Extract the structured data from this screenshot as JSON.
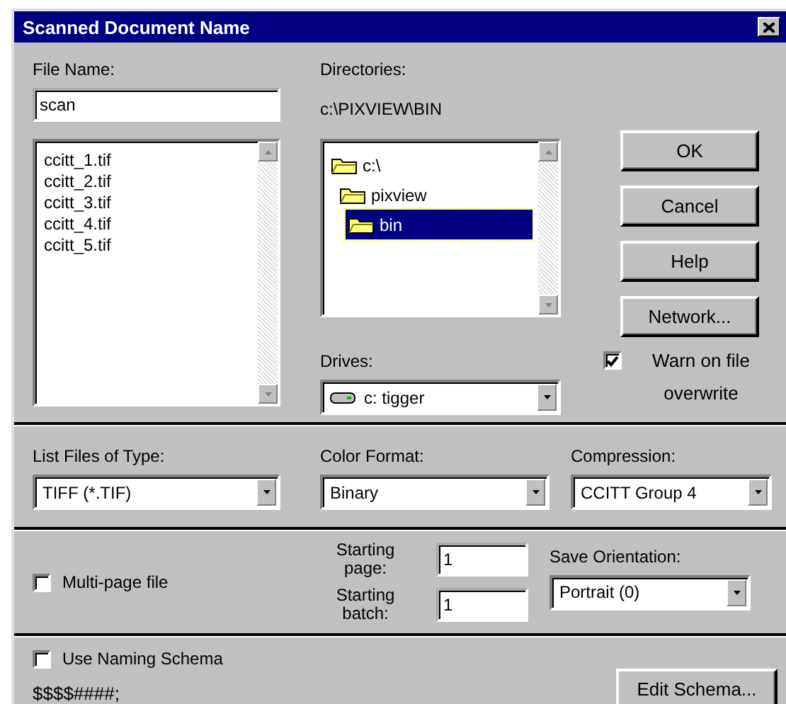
{
  "window": {
    "title": "Scanned Document Name"
  },
  "file_name": {
    "label": "File Name:",
    "value": "scan"
  },
  "file_list": {
    "items": [
      {
        "label": "ccitt_1.tif",
        "selected": false
      },
      {
        "label": "ccitt_2.tif",
        "selected": false
      },
      {
        "label": "ccitt_3.tif",
        "selected": false
      },
      {
        "label": "ccitt_4.tif",
        "selected": false
      },
      {
        "label": "ccitt_5.tif",
        "selected": false
      }
    ]
  },
  "directories": {
    "label": "Directories:",
    "path": "c:\\PIXVIEW\\BIN",
    "items": [
      {
        "label": "c:\\",
        "selected": false,
        "children": [
          {
            "label": "pixview",
            "selected": false,
            "children": [
              {
                "label": "bin",
                "selected": true
              }
            ]
          }
        ]
      }
    ]
  },
  "drives": {
    "label": "Drives:",
    "value": "c: tigger"
  },
  "buttons": [
    {
      "label": "OK"
    },
    {
      "label": "Cancel"
    },
    {
      "label": "Help"
    },
    {
      "label": "Network..."
    }
  ],
  "warn_overwrite": {
    "label": "Warn on file overwrite",
    "checked": true
  },
  "list_type": {
    "label": "List Files of Type:",
    "value": "TIFF (*.TIF)"
  },
  "color_format": {
    "label": "Color Format:",
    "value": "Binary"
  },
  "compression": {
    "label": "Compression:",
    "value": "CCITT Group 4"
  },
  "multi_page": {
    "label": "Multi-page file",
    "checked": false
  },
  "starting_page": {
    "label": "Starting page:",
    "value": "1"
  },
  "starting_batch": {
    "label": "Starting batch:",
    "value": "1"
  },
  "save_orientation": {
    "label": "Save Orientation:",
    "value": "Portrait (0)"
  },
  "naming_schema": {
    "label": "Use Naming Schema",
    "checked": false,
    "pattern": "$$$$####;"
  },
  "edit_schema_button": {
    "label": "Edit Schema..."
  }
}
